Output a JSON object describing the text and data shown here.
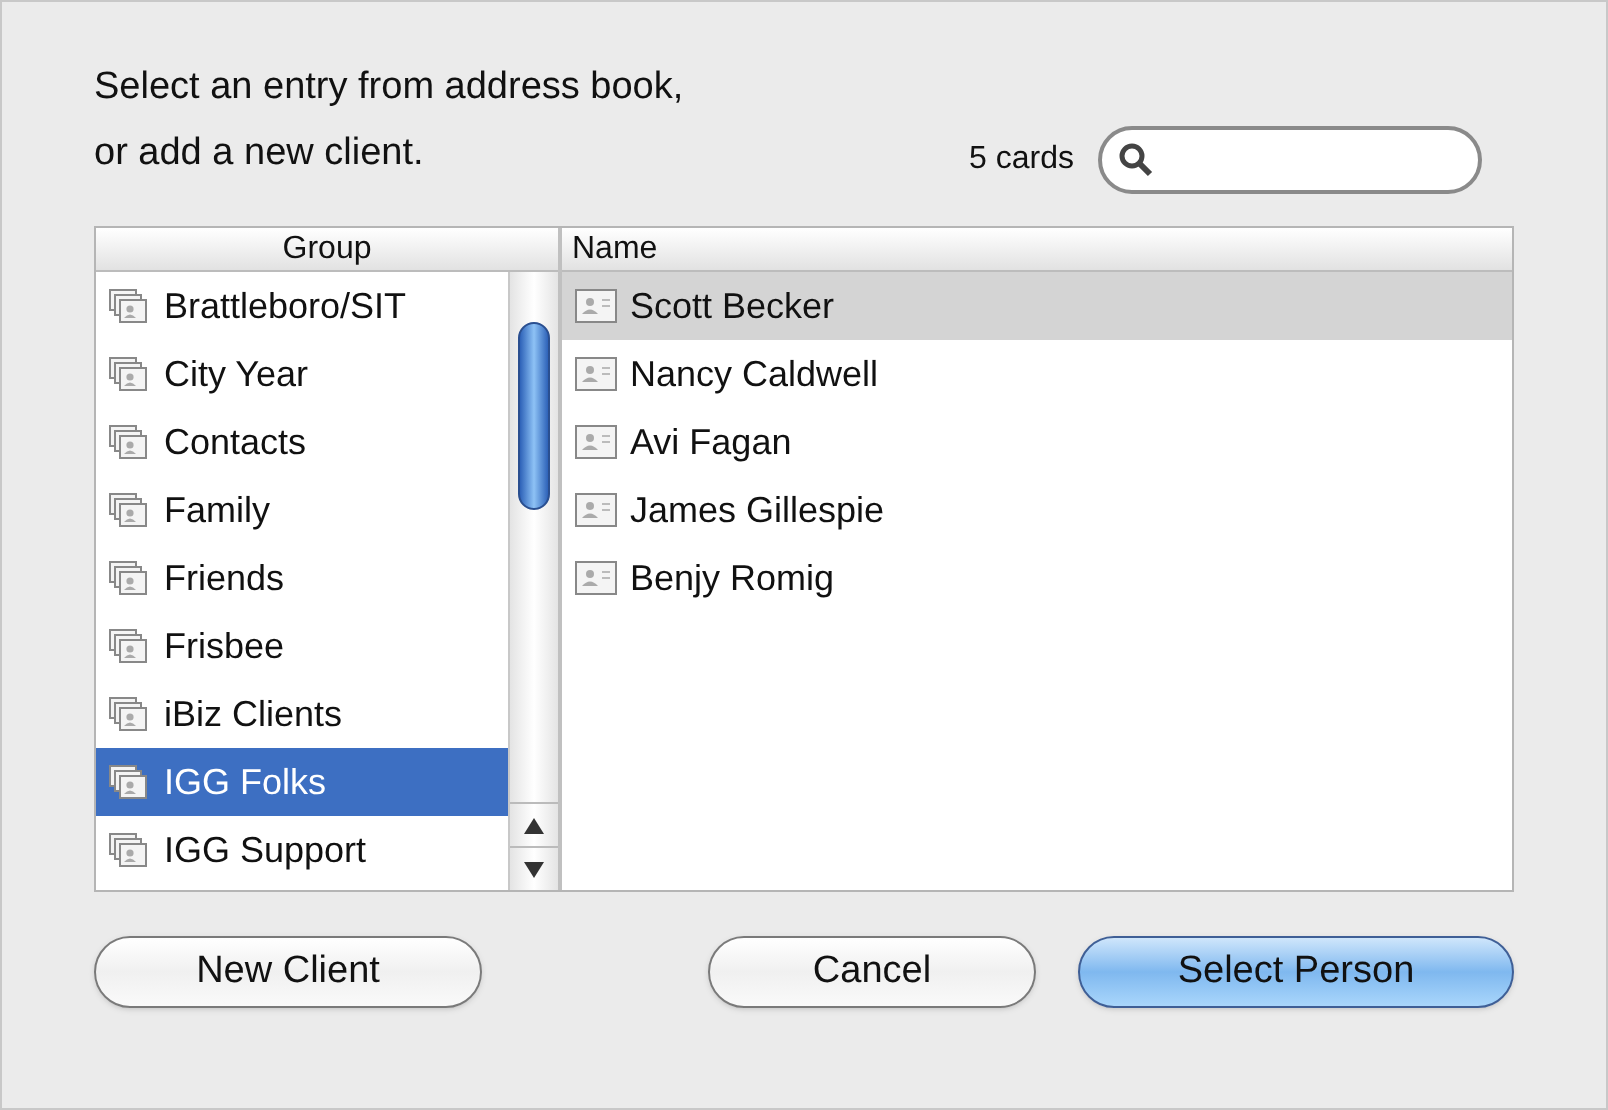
{
  "prompt": "Select an entry from address book,\nor add a new client.",
  "card_count": "5 cards",
  "groups": {
    "heading": "Group",
    "items": [
      {
        "label": "Brattleboro/SIT",
        "selected": false
      },
      {
        "label": "City Year",
        "selected": false
      },
      {
        "label": "Contacts",
        "selected": false
      },
      {
        "label": "Family",
        "selected": false
      },
      {
        "label": "Friends",
        "selected": false
      },
      {
        "label": "Frisbee",
        "selected": false
      },
      {
        "label": "iBiz Clients",
        "selected": false
      },
      {
        "label": "IGG Folks",
        "selected": true
      },
      {
        "label": "IGG Support",
        "selected": false
      }
    ]
  },
  "people": {
    "heading": "Name",
    "items": [
      {
        "label": "Scott Becker",
        "selected": true
      },
      {
        "label": "Nancy Caldwell",
        "selected": false
      },
      {
        "label": "Avi Fagan",
        "selected": false
      },
      {
        "label": "James Gillespie",
        "selected": false
      },
      {
        "label": "Benjy Romig",
        "selected": false
      }
    ]
  },
  "buttons": [
    {
      "label": "New Client",
      "kind": "plain"
    },
    {
      "label": "Cancel",
      "kind": "plain"
    },
    {
      "label": "Select Person",
      "kind": "default"
    }
  ]
}
